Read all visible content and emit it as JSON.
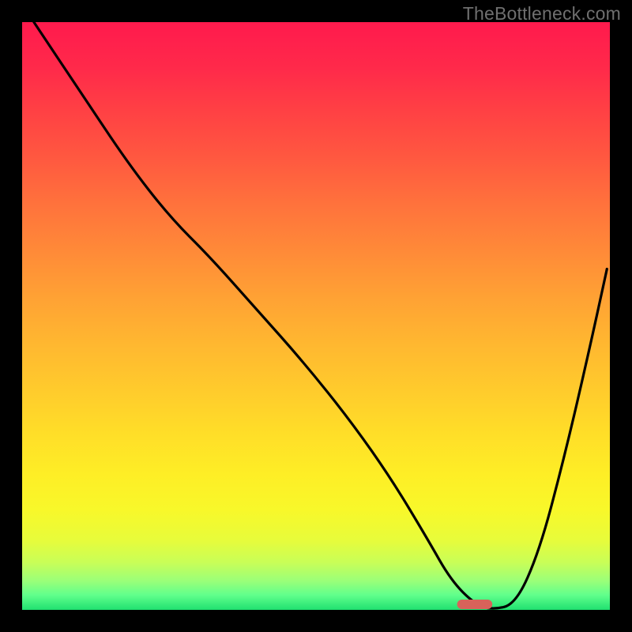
{
  "watermark": "TheBottleneck.com",
  "chart_data": {
    "type": "line",
    "title": "",
    "xlabel": "",
    "ylabel": "",
    "xlim": [
      0,
      100
    ],
    "ylim": [
      0,
      100
    ],
    "series": [
      {
        "name": "bottleneck-curve",
        "x": [
          2,
          10,
          18,
          25,
          32,
          40,
          48,
          56,
          63,
          69,
          73,
          77,
          80,
          84,
          88,
          92,
          96,
          99.5
        ],
        "values": [
          100,
          88,
          76,
          67,
          60,
          51,
          42,
          32,
          22,
          12,
          5,
          1,
          0,
          1,
          10,
          25,
          42,
          58
        ]
      }
    ],
    "marker": {
      "x_center": 77,
      "x_width": 6,
      "y": 0.6
    },
    "background_gradient": {
      "stops": [
        {
          "pos": 0,
          "color": "#ff1a4d"
        },
        {
          "pos": 50,
          "color": "#ffb02e"
        },
        {
          "pos": 83,
          "color": "#f8f82a"
        },
        {
          "pos": 100,
          "color": "#20e070"
        }
      ]
    }
  }
}
